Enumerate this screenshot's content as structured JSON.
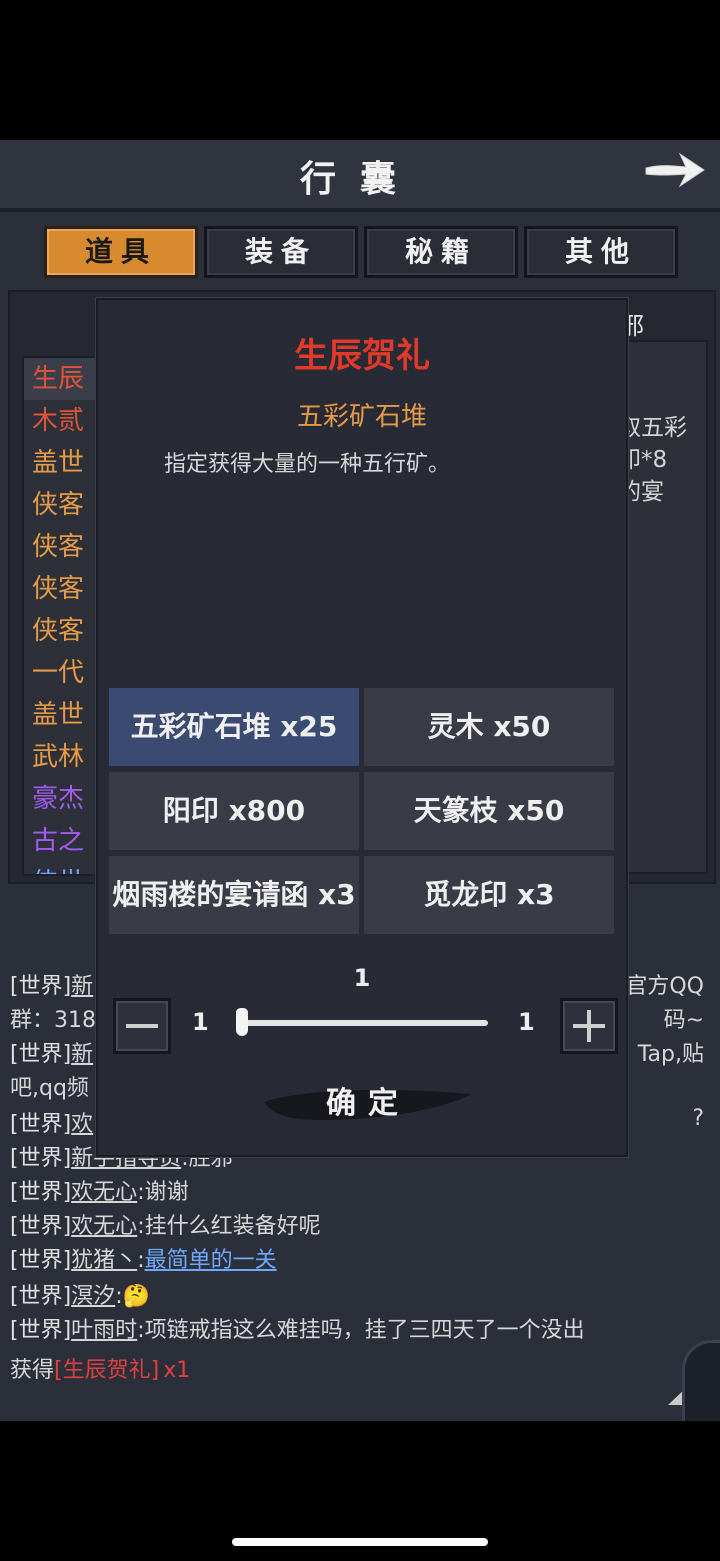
{
  "header": {
    "title": "行囊",
    "back_icon": "right-arrow-icon"
  },
  "tabs": [
    {
      "label": "道具",
      "active": true
    },
    {
      "label": "装备",
      "active": false
    },
    {
      "label": "秘籍",
      "active": false
    },
    {
      "label": "其他",
      "active": false
    }
  ],
  "panel": {
    "head_fragment": "邪"
  },
  "item_list": [
    {
      "text": "生辰",
      "color": "#e0553a"
    },
    {
      "text": "木贰",
      "color": "#e0553a"
    },
    {
      "text": "盖世",
      "color": "#e59a46"
    },
    {
      "text": "侠客",
      "color": "#e59a46"
    },
    {
      "text": "侠客",
      "color": "#e59a46"
    },
    {
      "text": "侠客",
      "color": "#e59a46"
    },
    {
      "text": "侠客",
      "color": "#e59a46"
    },
    {
      "text": "一代",
      "color": "#e59a46"
    },
    {
      "text": "盖世",
      "color": "#e59a46"
    },
    {
      "text": "武林",
      "color": "#e59a46"
    },
    {
      "text": "豪杰",
      "color": "#a45cf0"
    },
    {
      "text": "古之",
      "color": "#a45cf0"
    },
    {
      "text": "侠世",
      "color": "#6fa8ff"
    }
  ],
  "right_text": [
    "取五彩",
    "印*8",
    "的宴"
  ],
  "modal": {
    "title": "生辰贺礼",
    "selected_name": "五彩矿石堆",
    "description": "指定获得大量的一种五行矿。",
    "options": [
      {
        "label": "五彩矿石堆 x25",
        "selected": true
      },
      {
        "label": "灵木 x50",
        "selected": false
      },
      {
        "label": "阳印 x800",
        "selected": false
      },
      {
        "label": "天篆枝 x50",
        "selected": false
      },
      {
        "label": "烟雨楼的宴请函 x3",
        "selected": false
      },
      {
        "label": "觅龙印 x3",
        "selected": false
      }
    ],
    "quantity": {
      "current": "1",
      "min": "1",
      "max": "1",
      "fraction": 0
    },
    "confirm_label": "确定"
  },
  "chat": {
    "lines": [
      {
        "chan": "[世界]",
        "user": "新",
        "text": "",
        "right": "官方QQ"
      },
      {
        "chan": "",
        "user": "",
        "text": "群：318",
        "right": "码~"
      },
      {
        "chan": "[世界]",
        "user": "新",
        "text": "",
        "right": "Tap,贴"
      },
      {
        "chan": "",
        "user": "",
        "text": "吧,qq频",
        "right": ""
      },
      {
        "chan": "[世界]",
        "user": "欢",
        "text": "",
        "right": "?"
      },
      {
        "chan": "[世界]",
        "user": "新手指导员",
        "text": ":胜邪",
        "right": ""
      },
      {
        "chan": "[世界]",
        "user": "欢无心",
        "text": ":谢谢",
        "right": ""
      },
      {
        "chan": "[世界]",
        "user": "欢无心",
        "text": ":挂什么红装备好呢",
        "right": ""
      },
      {
        "chan": "[世界]",
        "user": "犹猪丶",
        "text": ":",
        "link": "最简单的一关",
        "right": ""
      },
      {
        "chan": "[世界]",
        "user": "溟汐",
        "text": ":",
        "emoji": "🤔",
        "right": ""
      },
      {
        "chan": "[世界]",
        "user": "叶雨时",
        "text": ":项链戒指这么难挂吗，挂了三四天了一个没出",
        "right": ""
      }
    ],
    "obtain": {
      "prefix": "获得",
      "item": "[生辰贺礼]",
      "count": "x1"
    }
  }
}
